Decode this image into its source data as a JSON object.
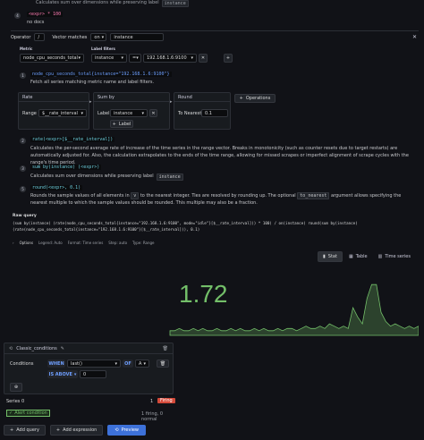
{
  "top_hint": {
    "text": "Calculates sum over dimensions while preserving label",
    "code": "instance"
  },
  "step4": {
    "num": "4",
    "code": "<expr> * 100",
    "desc": "no docs"
  },
  "operator_bar": {
    "operator_label": "Operator",
    "operator_value": "/",
    "vector_label": "Vector matches",
    "vector_value": "on",
    "on_value": "instance"
  },
  "metric": {
    "metric_label": "Metric",
    "metric_value": "node_cpu_seconds_total",
    "filters_label": "Label filters",
    "filter_key": "instance",
    "filter_op": "=",
    "filter_value": "192.168.1.6:9100"
  },
  "step1": {
    "num": "1",
    "code": "node_cpu_seconds_total{instance=\"192.168.1.6:9100\"}",
    "desc": "Fetch all series matching metric name and label filters."
  },
  "ops": {
    "rate_title": "Rate",
    "range_label": "Range",
    "range_value": "$__rate_interval",
    "sumby_title": "Sum by",
    "label_label": "Label",
    "label_value": "instance",
    "add_label": "Label",
    "round_title": "Round",
    "nearest_label": "To Nearest",
    "nearest_value": "0.1",
    "operations_btn": "Operations"
  },
  "step2": {
    "num": "2",
    "code": "rate(<expr>[$__rate_interval])",
    "desc": "Calculates the per-second average rate of increase of the time series in the range vector. Breaks in monotonicity (such as counter resets due to target restarts) are automatically adjusted for. Also, the calculation extrapolates to the ends of the time range, allowing for missed scrapes or imperfect alignment of scrape cycles with the range's time period."
  },
  "step3": {
    "num": "3",
    "code": "sum by(instance) (<expr>)",
    "desc_a": "Calculates sum over dimensions while preserving label",
    "desc_code": "instance"
  },
  "step5": {
    "num": "5",
    "code": "round(<expr>, 0.1)",
    "desc_a": "Rounds the sample values of all elements in",
    "code_v": "v",
    "desc_b": "to the nearest integer. Ties are resolved by rounding up. The optional",
    "code_tn": "to_nearest",
    "desc_c": "argument allows specifying the nearest multiple to which the sample values should be rounded. This multiple may also be a fraction."
  },
  "raw_query": {
    "label": "Raw query",
    "line1": "(sum by(instance) (rate(node_cpu_seconds_total{instance=\"192.168.1.6:9100\", mode=\"idle\"}[$__rate_interval])) * 100) / on(instance) round(sum by(instance)",
    "line2": "(rate(node_cpu_seconds_total{instance=\"192.168.1.6:9100\"}[$__rate_interval])), 0.1)"
  },
  "options_row": {
    "options": "Options",
    "legend": "Legend: Auto",
    "format": "Format: Time series",
    "step": "Step: auto",
    "type": "Type: Range"
  },
  "viz_tabs": [
    "Stat",
    "Table",
    "Time series"
  ],
  "stat": {
    "value": "1.72",
    "color": "#73bf69"
  },
  "condition": {
    "title": "Classic_conditions",
    "conditions_label": "Conditions",
    "when": "WHEN",
    "func": "last()",
    "of": "OF",
    "of_value": "A",
    "is_above": "IS ABOVE",
    "threshold": "0"
  },
  "series": {
    "label": "Series 0",
    "value": "1",
    "state": "Firing",
    "alert_badge": "Alert condition",
    "summary": "1 firing, 0 normal"
  },
  "actions": {
    "add_query": "Add query",
    "add_expression": "Add expression",
    "preview": "Preview"
  },
  "sparkline": [
    2,
    2,
    3,
    2,
    2,
    3,
    2,
    3,
    2,
    2,
    3,
    2,
    2,
    3,
    2,
    3,
    2,
    2,
    3,
    2,
    3,
    2,
    2,
    3,
    2,
    3,
    3,
    2,
    3,
    4,
    3,
    3,
    4,
    3,
    5,
    4,
    3,
    4,
    3,
    12,
    8,
    5,
    16,
    22,
    22,
    10,
    6,
    4,
    5,
    4,
    3,
    4,
    3,
    4
  ]
}
